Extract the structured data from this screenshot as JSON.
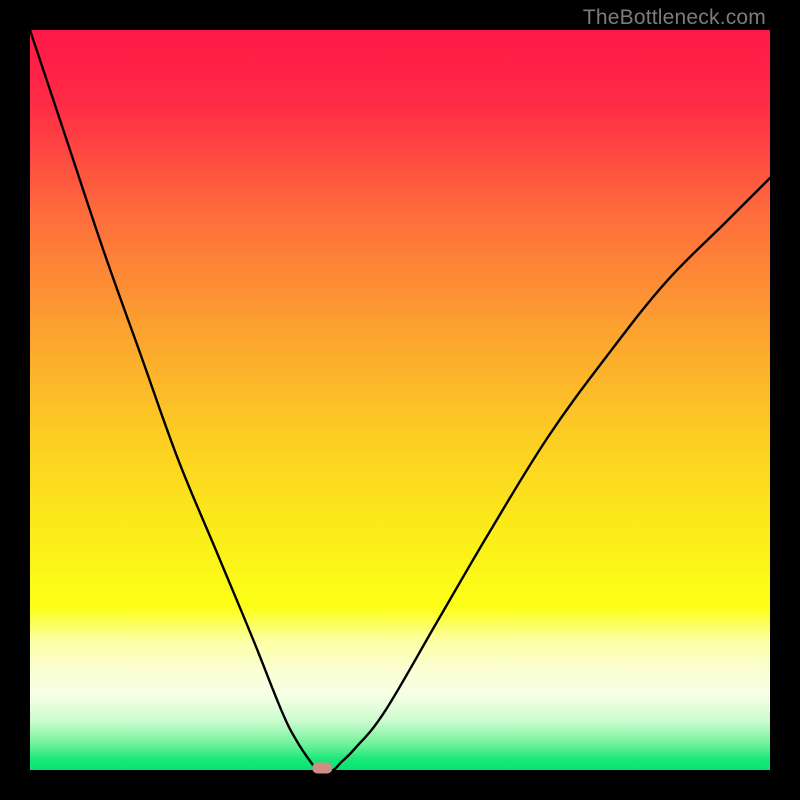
{
  "watermark": "TheBottleneck.com",
  "chart_data": {
    "type": "line",
    "title": "",
    "xlabel": "",
    "ylabel": "",
    "xlim": [
      0,
      100
    ],
    "ylim": [
      0,
      100
    ],
    "grid": false,
    "legend": false,
    "annotations": [],
    "series": [
      {
        "name": "bottleneck-curve",
        "color": "#000000",
        "x": [
          0,
          5,
          10,
          15,
          20,
          25,
          30,
          34,
          36,
          38,
          39,
          40,
          41,
          42,
          44,
          48,
          55,
          62,
          70,
          78,
          86,
          94,
          100
        ],
        "y": [
          100,
          85,
          70,
          56,
          42,
          30,
          18,
          8,
          4,
          1,
          0,
          0,
          0,
          1,
          3,
          8,
          20,
          32,
          45,
          56,
          66,
          74,
          80
        ]
      }
    ],
    "marker": {
      "name": "optimal-point",
      "x": 39.5,
      "y": 0,
      "color": "#cf8d88"
    },
    "background_gradient": {
      "stops": [
        {
          "offset": 0.0,
          "color": "#ff1847"
        },
        {
          "offset": 0.1,
          "color": "#ff2b45"
        },
        {
          "offset": 0.25,
          "color": "#fe6d3c"
        },
        {
          "offset": 0.4,
          "color": "#fca030"
        },
        {
          "offset": 0.55,
          "color": "#fcce23"
        },
        {
          "offset": 0.7,
          "color": "#fbf118"
        },
        {
          "offset": 0.78,
          "color": "#fdff17"
        },
        {
          "offset": 0.825,
          "color": "#fcffa3"
        },
        {
          "offset": 0.865,
          "color": "#fbffd3"
        },
        {
          "offset": 0.9,
          "color": "#f6ffe7"
        },
        {
          "offset": 0.935,
          "color": "#c9fbcd"
        },
        {
          "offset": 0.965,
          "color": "#70f29a"
        },
        {
          "offset": 0.985,
          "color": "#1be879"
        },
        {
          "offset": 1.0,
          "color": "#05e472"
        }
      ]
    }
  }
}
